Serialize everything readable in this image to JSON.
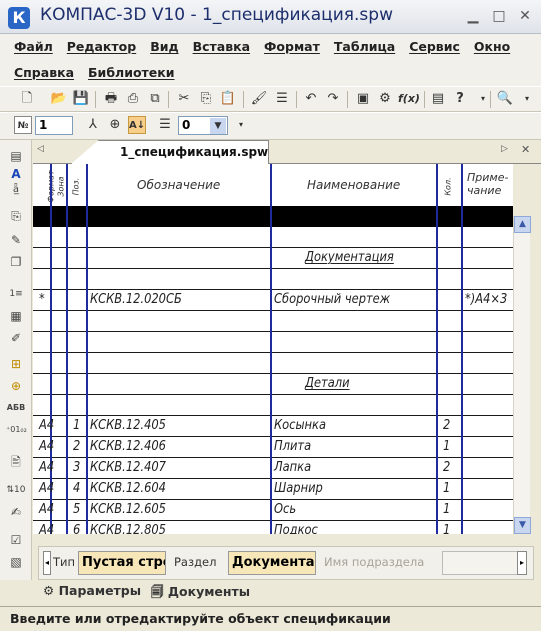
{
  "window": {
    "title": "КОМПАС-3D V10 - 1_спецификация.spw",
    "icon": "kompas-logo-icon"
  },
  "menu": {
    "row1": [
      "Файл",
      "Редактор",
      "Вид",
      "Вставка",
      "Формат",
      "Таблица",
      "Сервис",
      "Окно"
    ],
    "row2": [
      "Справка",
      "Библиотеки"
    ]
  },
  "toolbar2": {
    "page_value": "1",
    "zero_value": "0"
  },
  "tab": {
    "label": "1_спецификация.spw"
  },
  "columns": {
    "format": "Формат",
    "zone": "Зона",
    "pos": "Поз.",
    "designation": "Обозначение",
    "name": "Наименование",
    "qty": "Кол.",
    "note": "Приме-чание"
  },
  "rows": [
    {
      "fmt": "",
      "zone": "",
      "pos": "",
      "designation": "",
      "name": "Документация",
      "section": true,
      "qty": "",
      "note": ""
    },
    {
      "fmt": "*",
      "zone": "",
      "pos": "",
      "designation": "КСКВ.12.020СБ",
      "name": "Сборочный чертеж",
      "section": false,
      "qty": "",
      "note": "*)А4×3"
    },
    {
      "fmt": "",
      "zone": "",
      "pos": "",
      "designation": "",
      "name": "Детали",
      "section": true,
      "qty": "",
      "note": ""
    },
    {
      "fmt": "А4",
      "zone": "",
      "pos": "1",
      "designation": "КСКВ.12.405",
      "name": "Косынка",
      "section": false,
      "qty": "2",
      "note": ""
    },
    {
      "fmt": "А4",
      "zone": "",
      "pos": "2",
      "designation": "КСКВ.12.406",
      "name": "Плита",
      "section": false,
      "qty": "1",
      "note": ""
    },
    {
      "fmt": "А4",
      "zone": "",
      "pos": "3",
      "designation": "КСКВ.12.407",
      "name": "Лапка",
      "section": false,
      "qty": "2",
      "note": ""
    },
    {
      "fmt": "А4",
      "zone": "",
      "pos": "4",
      "designation": "КСКВ.12.604",
      "name": "Шарнир",
      "section": false,
      "qty": "1",
      "note": ""
    },
    {
      "fmt": "А4",
      "zone": "",
      "pos": "5",
      "designation": "КСКВ.12.605",
      "name": "Ось",
      "section": false,
      "qty": "1",
      "note": ""
    },
    {
      "fmt": "А4",
      "zone": "",
      "pos": "6",
      "designation": "КСКВ.12.805",
      "name": "Подкос",
      "section": false,
      "qty": "1",
      "note": ""
    }
  ],
  "editpanel": {
    "type_label": "Тип",
    "type_value": "Пустая строка",
    "section_label": "Раздел",
    "section_value": "Документация",
    "subsection_placeholder": "Имя подраздела"
  },
  "bottomtabs": [
    "Параметры",
    "Документы"
  ],
  "status": "Введите или отредактируйте объект спецификации"
}
